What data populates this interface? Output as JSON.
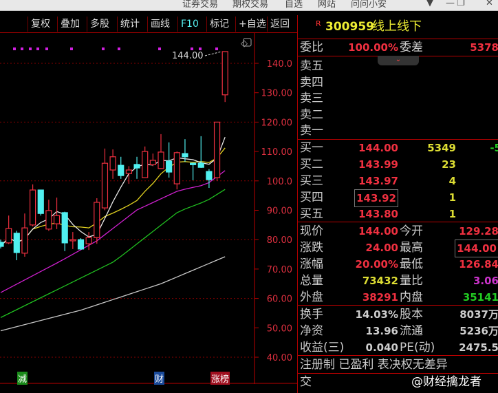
{
  "window_menu": [
    "证券交易",
    "期权交易",
    "自选",
    "网站",
    "问问小安"
  ],
  "toolbar": [
    "复权",
    "叠加",
    "多股",
    "统计",
    "画线",
    "F10",
    "标记",
    "+自选",
    "返回"
  ],
  "chart_data": {
    "type": "candlestick",
    "ylim": [
      40,
      140
    ],
    "yticks": [
      "140.0",
      "130.00",
      "120.00",
      "110.00",
      "100.0",
      "90.00",
      "80.00",
      "70.00",
      "60.00",
      "50.00",
      "40.00"
    ],
    "ytick_values": [
      140,
      130,
      120,
      110,
      100,
      90,
      80,
      70,
      60,
      50,
      40
    ],
    "last_price_label": "144.00",
    "candles": [
      [
        79.1,
        80,
        77,
        77.7
      ],
      [
        78.9,
        88.2,
        78.5,
        83.8
      ],
      [
        82.2,
        83,
        73,
        75.6
      ],
      [
        75.4,
        88.9,
        74.2,
        84.0
      ],
      [
        85.0,
        98.8,
        84.5,
        96.9
      ],
      [
        96.9,
        97,
        88.2,
        88.9
      ],
      [
        83.6,
        93.6,
        83,
        89.9
      ],
      [
        85.4,
        94.3,
        83.6,
        88.2
      ],
      [
        89.2,
        89.5,
        76.1,
        78.9
      ],
      [
        79.6,
        82.6,
        76.8,
        80.0
      ],
      [
        80.0,
        80.5,
        76.5,
        76.8
      ],
      [
        78.6,
        82.6,
        76.5,
        80.7
      ],
      [
        80.7,
        94.1,
        78.6,
        92.7
      ],
      [
        90.8,
        111.0,
        90,
        106.0
      ],
      [
        103.7,
        110.7,
        100.7,
        108.2
      ],
      [
        105.3,
        108.2,
        100.7,
        101.8
      ],
      [
        102.5,
        105.0,
        99.0,
        103.7
      ],
      [
        105.6,
        108.2,
        100.7,
        104.4
      ],
      [
        101.1,
        111.7,
        101,
        110.0
      ],
      [
        105.5,
        109.3,
        105.0,
        107.0
      ],
      [
        104.2,
        115.9,
        104,
        109.8
      ],
      [
        106.7,
        113.1,
        101.1,
        103.0
      ],
      [
        99.0,
        110,
        97.1,
        109.6
      ],
      [
        109.3,
        114.2,
        106.5,
        108.2
      ],
      [
        106.0,
        106.2,
        100.2,
        105.5
      ],
      [
        106.0,
        115.2,
        104.4,
        104.6
      ],
      [
        103.2,
        104,
        97.6,
        100.4
      ],
      [
        101.1,
        120,
        100,
        120
      ],
      [
        129.28,
        144,
        126.84,
        144
      ]
    ],
    "ma_lines": [
      {
        "name": "MA20",
        "color": "#d020d0",
        "points": [
          [
            0,
            62
          ],
          [
            7.4,
            72.6
          ],
          [
            12,
            79.6
          ],
          [
            17,
            90.1
          ],
          [
            22.2,
            96.7
          ],
          [
            25.7,
            98.8
          ],
          [
            28,
            103.5
          ]
        ]
      },
      {
        "name": "MA60",
        "color": "#20c020",
        "points": [
          [
            0,
            53.5
          ],
          [
            14.2,
            72.6
          ],
          [
            22.2,
            89.6
          ],
          [
            25.7,
            93.2
          ],
          [
            28,
            97.1
          ]
        ]
      },
      {
        "name": "MA120",
        "color": "#c8c8c8",
        "points": [
          [
            0,
            49
          ],
          [
            10,
            56
          ],
          [
            20,
            65
          ],
          [
            28,
            74.2
          ]
        ]
      }
    ],
    "colors": {
      "up": "#f03040",
      "down": "#50f0f0",
      "ma5": "#e8e8e8",
      "ma10": "#e0d020"
    },
    "event_tags": [
      {
        "text": "减",
        "color": "#1a8a1a"
      },
      {
        "text": "财",
        "color": "#1a4a9a"
      },
      {
        "text": "涨榜",
        "color": "#a01020"
      }
    ]
  },
  "quote": {
    "badge": "R",
    "code": "300959",
    "name": "线上线下",
    "weibi_label": "委比",
    "weibi": "100.00%",
    "weicha_label": "委差",
    "weicha": "5378",
    "sell": [
      {
        "label": "卖五"
      },
      {
        "label": "卖四"
      },
      {
        "label": "卖三"
      },
      {
        "label": "卖二"
      },
      {
        "label": "卖一"
      }
    ],
    "buy": [
      {
        "label": "买一",
        "price": "144.00",
        "vol": "5349",
        "chg": "-5"
      },
      {
        "label": "买二",
        "price": "143.99",
        "vol": "23"
      },
      {
        "label": "买三",
        "price": "143.97",
        "vol": "4"
      },
      {
        "label": "买四",
        "price": "143.92",
        "vol": "1"
      },
      {
        "label": "买五",
        "price": "143.80",
        "vol": "1"
      }
    ],
    "stats": [
      {
        "l1": "现价",
        "v1": "144.00",
        "c1": "red",
        "l2": "今开",
        "v2": "129.28",
        "c2": "red"
      },
      {
        "l1": "涨跌",
        "v1": "24.00",
        "c1": "red",
        "l2": "最高",
        "v2": "144.00",
        "c2": "red"
      },
      {
        "l1": "涨幅",
        "v1": "20.00%",
        "c1": "red",
        "l2": "最低",
        "v2": "126.84",
        "c2": "red"
      },
      {
        "l1": "总量",
        "v1": "73432",
        "c1": "yel",
        "l2": "量比",
        "v2": "3.06",
        "c2": "mag"
      },
      {
        "l1": "外盘",
        "v1": "38291",
        "c1": "red",
        "l2": "内盘",
        "v2": "35141",
        "c2": "grn"
      }
    ],
    "fund": [
      {
        "l1": "换手",
        "v1": "14.03%",
        "l2": "股本",
        "v2": "8037万"
      },
      {
        "l1": "净资",
        "v1": "13.96",
        "l2": "流通",
        "v2": "5236万"
      },
      {
        "l1": "收益(三)",
        "v1": "0.040",
        "l2": "PE(动)",
        "v2": "2475.5"
      }
    ],
    "tags_line": "注册制 已盈利 表决权无差异",
    "last_line": "交",
    "watermark": "@财经擒龙者"
  }
}
